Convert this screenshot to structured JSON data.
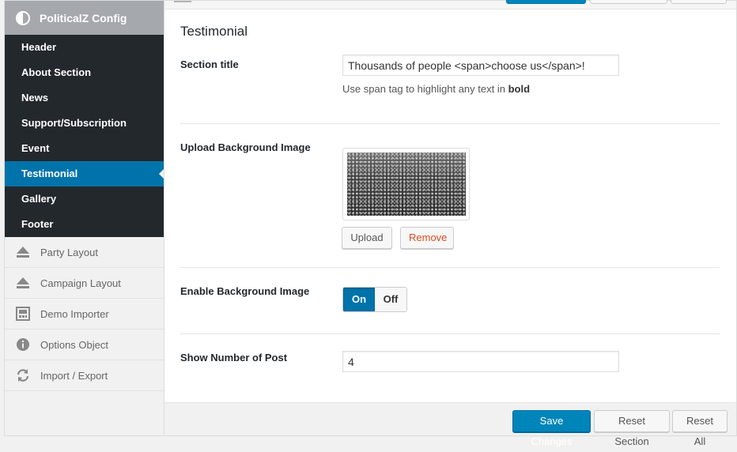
{
  "sidebar": {
    "title": "PoliticalZ Config",
    "sub_items": [
      {
        "label": "Header"
      },
      {
        "label": "About Section"
      },
      {
        "label": "News"
      },
      {
        "label": "Support/Subscription"
      },
      {
        "label": "Event"
      },
      {
        "label": "Testimonial",
        "active": true
      },
      {
        "label": "Gallery"
      },
      {
        "label": "Footer"
      }
    ],
    "menu_items": [
      {
        "label": "Party Layout",
        "icon": "eject-icon"
      },
      {
        "label": "Campaign Layout",
        "icon": "eject-icon"
      },
      {
        "label": "Demo Importer",
        "icon": "importer-icon"
      },
      {
        "label": "Options Object",
        "icon": "info-icon"
      },
      {
        "label": "Import / Export",
        "icon": "refresh-icon"
      }
    ]
  },
  "main": {
    "section_heading": "Testimonial",
    "fields": {
      "section_title": {
        "label": "Section title",
        "value": "Thousands of people <span>choose us</span>!",
        "description_prefix": "Use span tag to highlight any text in ",
        "description_bold": "bold"
      },
      "background_image": {
        "label": "Upload Background Image",
        "upload_label": "Upload",
        "remove_label": "Remove"
      },
      "enable_background": {
        "label": "Enable Background Image",
        "on_label": "On",
        "off_label": "Off",
        "state": "on"
      },
      "post_count": {
        "label": "Show Number of Post",
        "value": "4"
      }
    },
    "footer": {
      "save_label": "Save Changes",
      "reset_section_label": "Reset Section",
      "reset_all_label": "Reset All"
    }
  },
  "colors": {
    "accent": "#0073aa",
    "primary_button": "#0085ba",
    "sidebar_dark": "#23282d",
    "sidebar_header": "#a5a9ad",
    "remove": "#d54e21"
  }
}
